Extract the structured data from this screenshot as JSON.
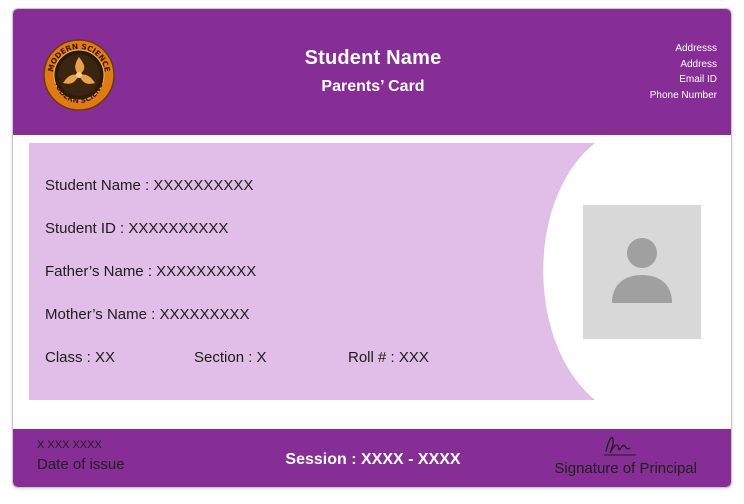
{
  "colors": {
    "header_bg": "#862d96",
    "panel_bg": "#e1bee7",
    "photo_bg": "#d8d8d8",
    "photo_icon": "#a0a0a0",
    "logo_ring": "#e07a14"
  },
  "header": {
    "title": "Student Name",
    "subtitle": "Parents’ Card",
    "contact": [
      "Addresss",
      "Address",
      "Email ID",
      "Phone Number"
    ]
  },
  "logo": {
    "icon": "school-seal-icon",
    "ring_text": "MODERN SCIENCE"
  },
  "fields": {
    "student_name": "Student Name :  XXXXXXXXXX",
    "student_id": "Student ID :  XXXXXXXXXX",
    "father_name": "Father’s Name :  XXXXXXXXXX",
    "mother_name": "Mother’s Name :  XXXXXXXXX",
    "class": "Class : XX",
    "section": "Section : X",
    "roll": "Roll # : XXX"
  },
  "photo": {
    "icon": "person-icon"
  },
  "footer": {
    "issue_date": "X XXX XXXX",
    "issue_label": "Date of issue",
    "session": "Session : XXXX - XXXX",
    "signature_icon": "signature-icon",
    "signature_label": "Signature of Principal"
  }
}
